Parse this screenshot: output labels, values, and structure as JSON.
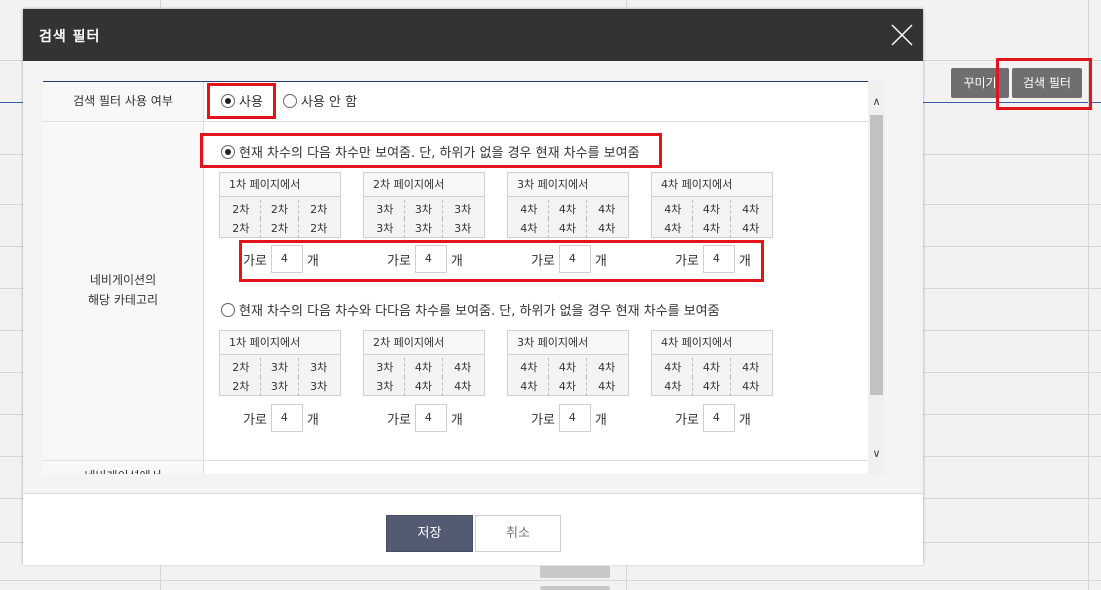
{
  "background": {
    "btn_decorate": "꾸미기",
    "btn_search_filter": "검색 필터"
  },
  "modal": {
    "title": "검색 필터",
    "save_label": "저장",
    "cancel_label": "취소"
  },
  "filter_use": {
    "label": "검색 필터 사용 여부",
    "options": [
      "사용",
      "사용 안 함"
    ],
    "selected": "사용"
  },
  "nav_category": {
    "label_line1": "네비게이션의",
    "label_line2": "해당 카테고리",
    "next_row_label": "네비게이션에서",
    "option1": {
      "label": "현재 차수의 다음 차수만 보여줌. 단, 하위가 없을 경우 현재 차수를 보여줌",
      "selected": true,
      "previews": [
        {
          "title": "1차 페이지에서",
          "cells": [
            "2차",
            "2차",
            "2차",
            "2차",
            "2차",
            "2차"
          ]
        },
        {
          "title": "2차 페이지에서",
          "cells": [
            "3차",
            "3차",
            "3차",
            "3차",
            "3차",
            "3차"
          ]
        },
        {
          "title": "3차 페이지에서",
          "cells": [
            "4차",
            "4차",
            "4차",
            "4차",
            "4차",
            "4차"
          ]
        },
        {
          "title": "4차 페이지에서",
          "cells": [
            "4차",
            "4차",
            "4차",
            "4차",
            "4차",
            "4차"
          ]
        }
      ],
      "count_prefix": "가로",
      "count_suffix": "개",
      "counts": [
        "4",
        "4",
        "4",
        "4"
      ]
    },
    "option2": {
      "label": "현재 차수의 다음 차수와 다다음 차수를 보여줌. 단, 하위가 없을 경우 현재 차수를 보여줌",
      "selected": false,
      "previews": [
        {
          "title": "1차 페이지에서",
          "cells": [
            "2차",
            "3차",
            "3차",
            "2차",
            "3차",
            "3차"
          ]
        },
        {
          "title": "2차 페이지에서",
          "cells": [
            "3차",
            "4차",
            "4차",
            "3차",
            "4차",
            "4차"
          ]
        },
        {
          "title": "3차 페이지에서",
          "cells": [
            "4차",
            "4차",
            "4차",
            "4차",
            "4차",
            "4차"
          ]
        },
        {
          "title": "4차 페이지에서",
          "cells": [
            "4차",
            "4차",
            "4차",
            "4차",
            "4차",
            "4차"
          ]
        }
      ],
      "count_prefix": "가로",
      "count_suffix": "개",
      "counts": [
        "4",
        "4",
        "4",
        "4"
      ]
    }
  },
  "colors": {
    "header": "#333333",
    "save_button": "#525b72",
    "highlight": "#e2131b",
    "panel_top_line": "#1e3c78"
  }
}
